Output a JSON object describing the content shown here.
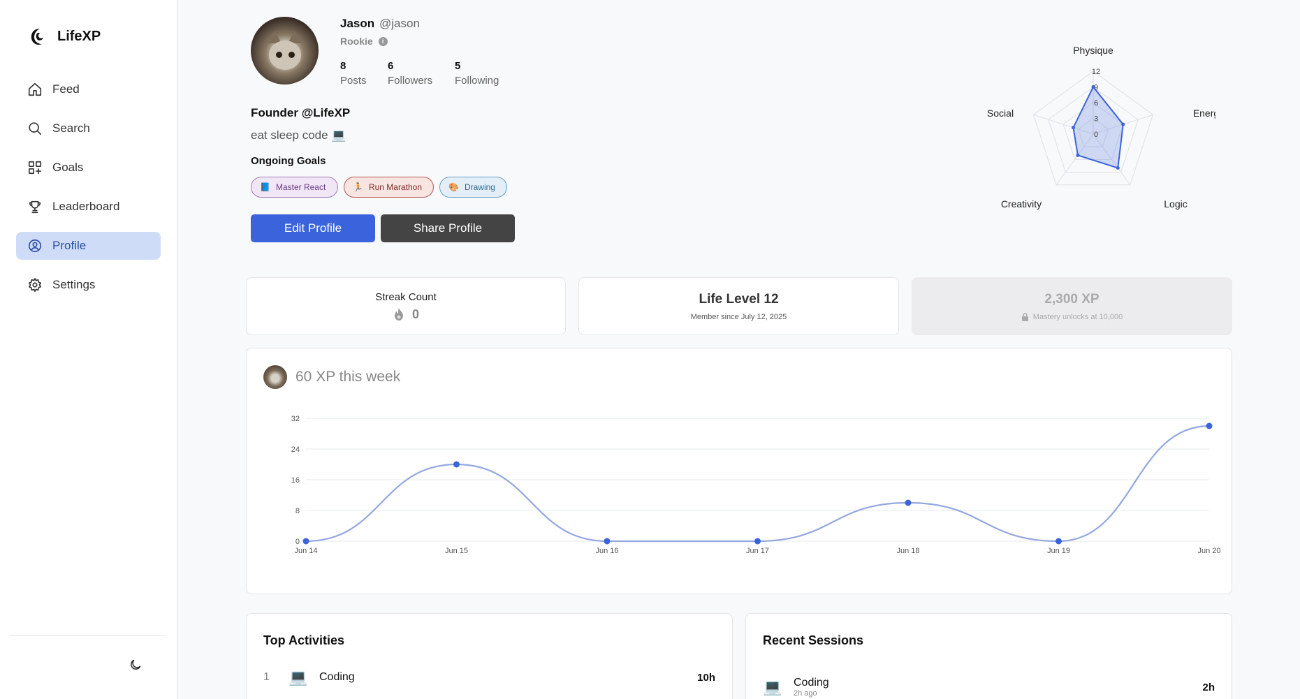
{
  "app": {
    "name": "LifeXP"
  },
  "nav": {
    "items": [
      {
        "label": "Feed",
        "icon": "home-icon"
      },
      {
        "label": "Search",
        "icon": "search-icon"
      },
      {
        "label": "Goals",
        "icon": "goals-icon"
      },
      {
        "label": "Leaderboard",
        "icon": "trophy-icon"
      },
      {
        "label": "Profile",
        "icon": "user-circle-icon",
        "active": true
      },
      {
        "label": "Settings",
        "icon": "gear-icon"
      }
    ]
  },
  "profile": {
    "name": "Jason",
    "handle": "@jason",
    "rank": "Rookie",
    "stats": [
      {
        "value": "8",
        "label": "Posts"
      },
      {
        "value": "6",
        "label": "Followers"
      },
      {
        "value": "5",
        "label": "Following"
      }
    ],
    "bio_title": "Founder @LifeXP",
    "bio_text": "eat sleep code 💻",
    "goals_title": "Ongoing Goals",
    "goals": [
      {
        "icon": "📘",
        "label": "Master React"
      },
      {
        "icon": "🏃",
        "label": "Run Marathon"
      },
      {
        "icon": "🎨",
        "label": "Drawing"
      }
    ],
    "edit_label": "Edit Profile",
    "share_label": "Share Profile"
  },
  "radar": {
    "axes": [
      "Physique",
      "Energy",
      "Logic",
      "Creativity",
      "Social"
    ],
    "ticks": [
      "0",
      "3",
      "6",
      "9",
      "12"
    ],
    "max": 12,
    "values": [
      9,
      6,
      8,
      5,
      4
    ]
  },
  "cards": {
    "streak_title": "Streak Count",
    "streak_value": "0",
    "level_title": "Life Level 12",
    "level_sub": "Member since July 12, 2025",
    "xp_title": "2,300 XP",
    "xp_sub": "Mastery unlocks at 10,000"
  },
  "weekly": {
    "title": "60 XP this week"
  },
  "chart_data": {
    "type": "line",
    "x": [
      "Jun 14",
      "Jun 15",
      "Jun 16",
      "Jun 17",
      "Jun 18",
      "Jun 19",
      "Jun 20"
    ],
    "values": [
      0,
      20,
      0,
      0,
      10,
      0,
      30
    ],
    "yticks": [
      0,
      8,
      16,
      24,
      32
    ],
    "ylim": [
      0,
      32
    ],
    "grid": true,
    "color": "#3b63dc"
  },
  "top_activities": {
    "title": "Top Activities",
    "items": [
      {
        "rank": "1",
        "icon": "💻",
        "name": "Coding",
        "value": "10h"
      }
    ]
  },
  "recent_sessions": {
    "title": "Recent Sessions",
    "items": [
      {
        "icon": "💻",
        "name": "Coding",
        "time": "2h ago",
        "value": "2h"
      }
    ]
  }
}
